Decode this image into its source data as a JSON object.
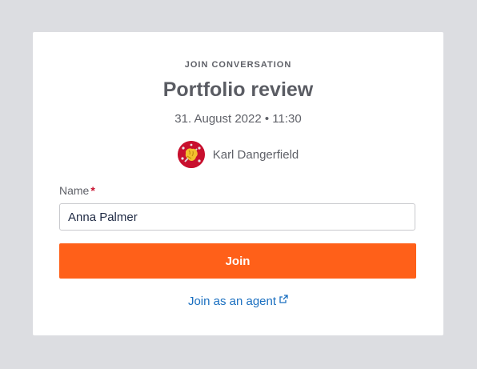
{
  "header": {
    "eyebrow": "JOIN CONVERSATION",
    "title": "Portfolio review",
    "datetime": "31. August 2022 • 11:30"
  },
  "host": {
    "name": "Karl Dangerfield",
    "avatar_icon": "lion-coat-of-arms-icon"
  },
  "form": {
    "name_label": "Name",
    "required_marker": "*",
    "name_value": "Anna Palmer",
    "join_label": "Join"
  },
  "agent_link": {
    "label": "Join as an agent",
    "icon": "external-link-icon"
  },
  "colors": {
    "accent": "#ff6019",
    "link": "#1a6fc0",
    "required": "#c8102e",
    "page_bg": "#dcdde1"
  }
}
